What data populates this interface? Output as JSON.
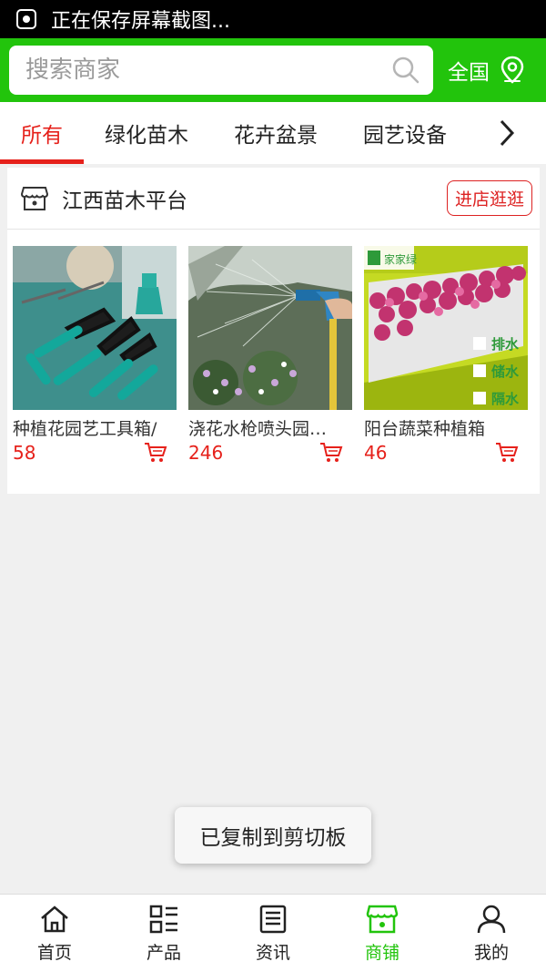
{
  "status_bar": {
    "text": "正在保存屏幕截图..."
  },
  "search": {
    "placeholder": "搜索商家",
    "region_label": "全国"
  },
  "tabs": [
    {
      "label": "所有"
    },
    {
      "label": "绿化苗木"
    },
    {
      "label": "花卉盆景"
    },
    {
      "label": "园艺设备"
    }
  ],
  "store": {
    "name": "江西苗木平台",
    "visit_label": "进店逛逛",
    "products": [
      {
        "name": "种植花园艺工具箱/",
        "price": "58"
      },
      {
        "name": "浇花水枪喷头园…",
        "price": "246"
      },
      {
        "name": "阳台蔬菜种植箱",
        "price": "46"
      }
    ]
  },
  "product_image_text": {
    "brand": "家家绿",
    "tags": [
      "排水",
      "储水",
      "隔水"
    ]
  },
  "toast": {
    "text": "已复制到剪切板"
  },
  "bottom_nav": [
    {
      "label": "首页",
      "icon": "home-icon"
    },
    {
      "label": "产品",
      "icon": "list-icon"
    },
    {
      "label": "资讯",
      "icon": "news-icon"
    },
    {
      "label": "商铺",
      "icon": "store-icon"
    },
    {
      "label": "我的",
      "icon": "user-icon"
    }
  ],
  "colors": {
    "brand_green": "#22c40c",
    "accent_red": "#e6211b"
  }
}
